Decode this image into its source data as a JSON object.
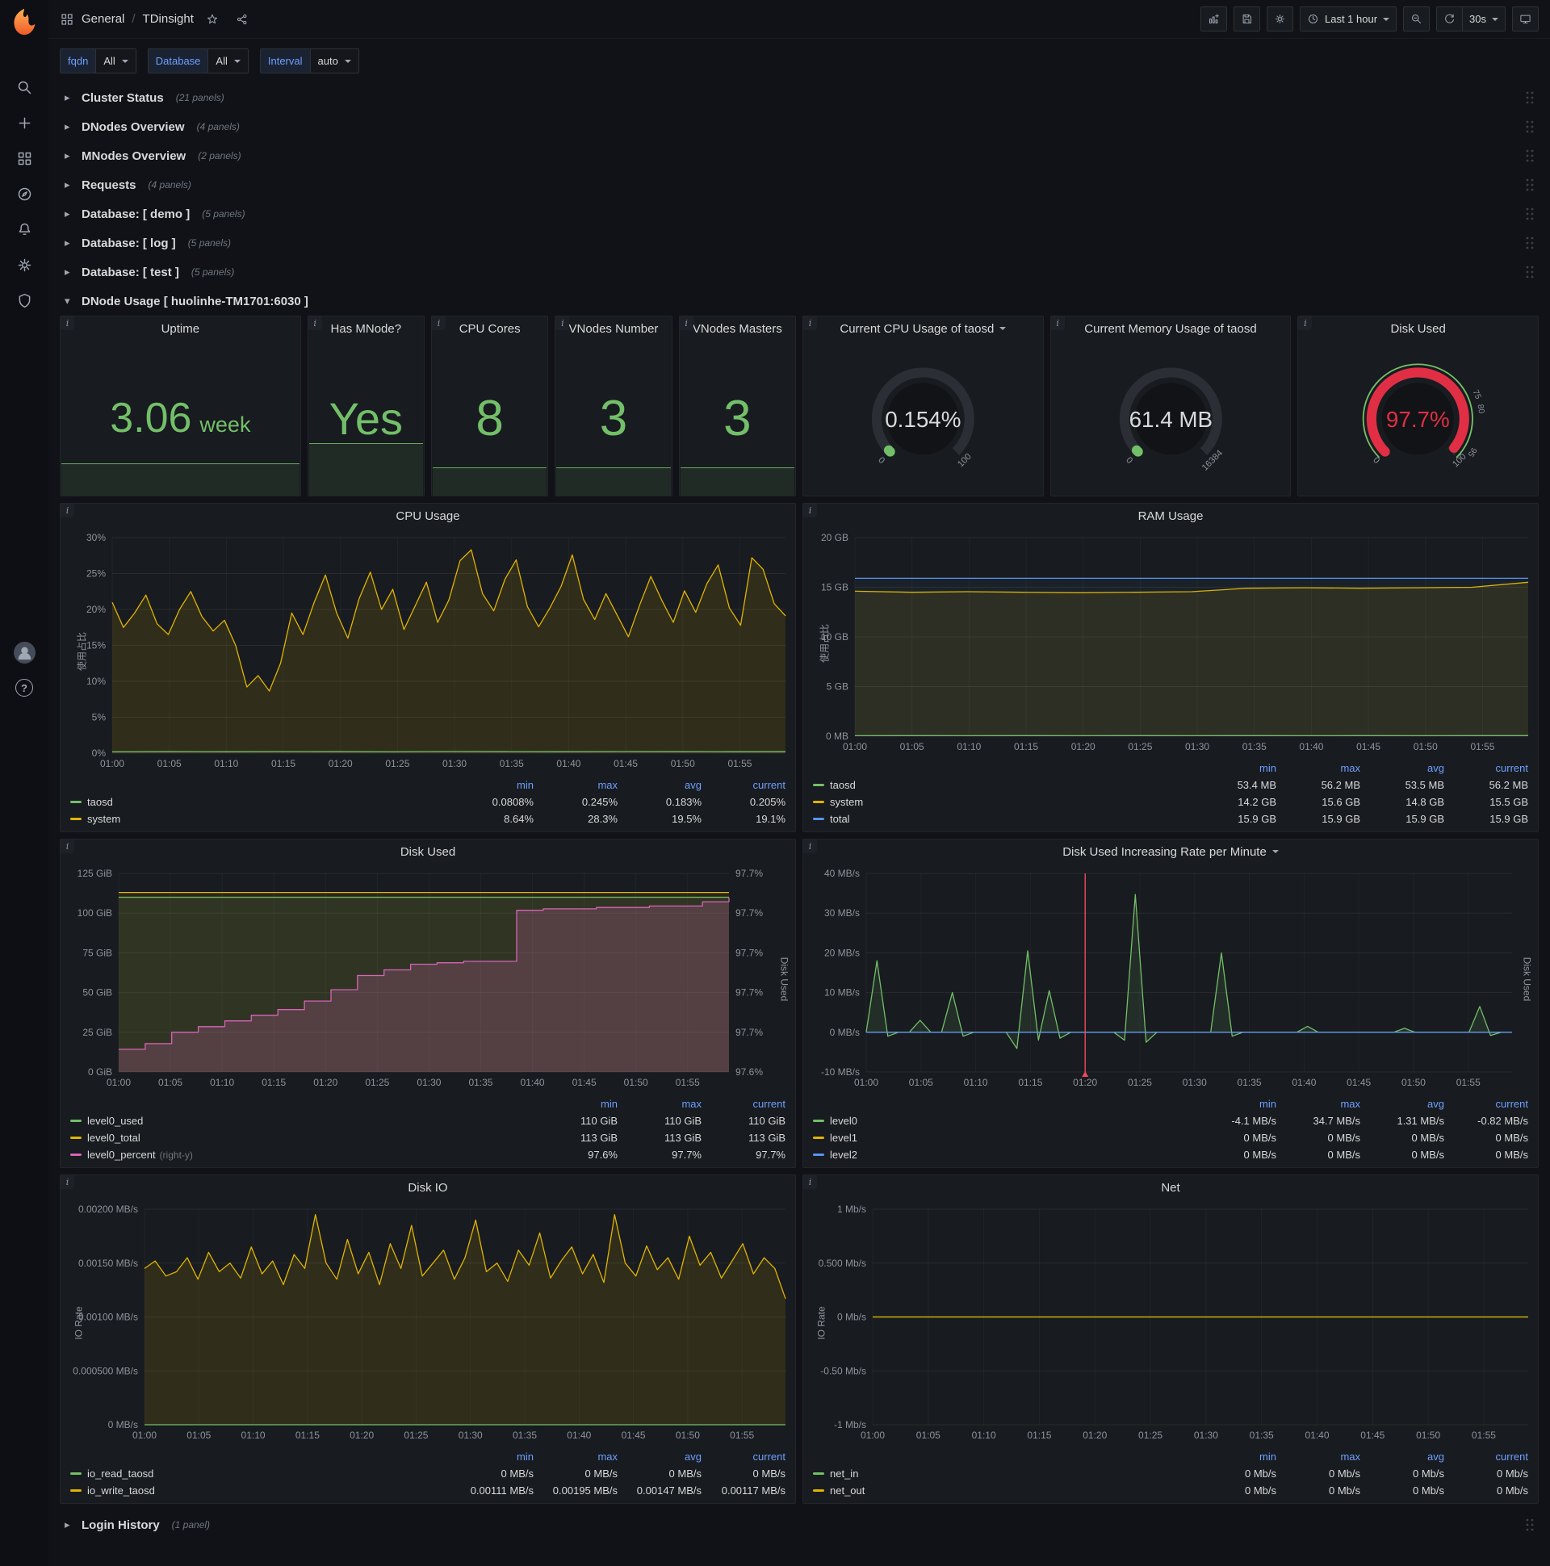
{
  "colors": {
    "green": "#73bf69",
    "yellow": "#e0b400",
    "blue": "#5794f2",
    "pink": "#d864b8",
    "red": "#e02f44"
  },
  "nav": {
    "breadcrumb_section": "General",
    "breadcrumb_sep": "/",
    "title": "TDinsight",
    "time_range": "Last 1 hour",
    "refresh_interval": "30s"
  },
  "variables": [
    {
      "label": "fqdn",
      "value": "All"
    },
    {
      "label": "Database",
      "value": "All"
    },
    {
      "label": "Interval",
      "value": "auto"
    }
  ],
  "collapsed_rows": [
    {
      "title": "Cluster Status",
      "count": "(21 panels)"
    },
    {
      "title": "DNodes Overview",
      "count": "(4 panels)"
    },
    {
      "title": "MNodes Overview",
      "count": "(2 panels)"
    },
    {
      "title": "Requests",
      "count": "(4 panels)"
    },
    {
      "title": "Database: [ demo ]",
      "count": "(5 panels)"
    },
    {
      "title": "Database: [ log ]",
      "count": "(5 panels)"
    },
    {
      "title": "Database: [ test ]",
      "count": "(5 panels)"
    }
  ],
  "expanded_row": {
    "title": "DNode Usage [ huolinhe-TM1701:6030 ]"
  },
  "bottom_row": {
    "title": "Login History",
    "count": "(1 panel)"
  },
  "stats": [
    {
      "title": "Uptime",
      "value": "3.06",
      "unit": "week",
      "spark": 0.21
    },
    {
      "title": "Has MNode?",
      "value": "Yes",
      "unit": "",
      "spark": 0.34
    },
    {
      "title": "CPU Cores",
      "value": "8",
      "unit": "",
      "spark": 0.18
    },
    {
      "title": "VNodes Number",
      "value": "3",
      "unit": "",
      "spark": 0.18
    },
    {
      "title": "VNodes Masters",
      "value": "3",
      "unit": "",
      "spark": 0.18
    }
  ],
  "gauges": [
    {
      "title": "Current CPU Usage of taosd",
      "caret": true,
      "value": "0.154%",
      "pct": 0.154,
      "min_label": "0",
      "max_label": "100",
      "color": "#73bf69",
      "value_color": "#d8d9da",
      "thresholds": []
    },
    {
      "title": "Current Memory Usage of taosd",
      "caret": false,
      "value": "61.4 MB",
      "pct": 0.375,
      "min_label": "0",
      "max_label": "16384",
      "color": "#73bf69",
      "value_color": "#d8d9da",
      "thresholds": []
    },
    {
      "title": "Disk Used",
      "caret": false,
      "value": "97.7%",
      "pct": 97.7,
      "min_label": "0",
      "max_label": "100",
      "color": "#e02f44",
      "value_color": "#e02f44",
      "outer_ring": "#73bf69",
      "thresholds": [
        {
          "pos": 75,
          "label": "75"
        },
        {
          "pos": 80,
          "label": "80"
        },
        {
          "pos": 95,
          "label": "95"
        }
      ]
    }
  ],
  "chart_data": [
    {
      "type": "line",
      "title": "CPU Usage",
      "caret": false,
      "ylabel": "使用占比",
      "ml": 64,
      "ymin": 0,
      "ymax": 30,
      "yticks": [
        "30%",
        "25%",
        "20%",
        "15%",
        "10%",
        "5%",
        "0%"
      ],
      "xticks": [
        "01:00",
        "01:05",
        "01:10",
        "01:15",
        "01:20",
        "01:25",
        "01:30",
        "01:35",
        "01:40",
        "01:45",
        "01:50",
        "01:55"
      ],
      "x_minutes": 59,
      "series": [
        {
          "name": "system",
          "color": "#e0b400",
          "fill": 0.12,
          "values": [
            21.0,
            17.5,
            19.5,
            22.0,
            18.0,
            16.5,
            20.0,
            22.5,
            19.0,
            17.0,
            18.5,
            15.0,
            9.2,
            10.8,
            8.64,
            12.5,
            19.5,
            16.5,
            21.0,
            24.8,
            19.5,
            16.0,
            21.5,
            25.2,
            20.0,
            22.8,
            17.2,
            20.5,
            23.8,
            18.2,
            21.3,
            26.8,
            28.3,
            22.2,
            19.8,
            24.2,
            26.9,
            20.4,
            17.6,
            20.2,
            23.2,
            27.6,
            21.4,
            18.6,
            22.2,
            19.2,
            16.2,
            20.6,
            24.6,
            21.2,
            18.2,
            22.6,
            19.6,
            23.6,
            26.2,
            20.2,
            17.8,
            27.2,
            25.6,
            20.8,
            19.1
          ]
        },
        {
          "name": "taosd",
          "color": "#73bf69",
          "fill": 0.05,
          "values": [
            0.18,
            0.2,
            0.19,
            0.21,
            0.2,
            0.18,
            0.22,
            0.2,
            0.19,
            0.21,
            0.2,
            0.19,
            0.205
          ]
        }
      ],
      "legend": {
        "headers": [
          "min",
          "max",
          "avg",
          "current"
        ],
        "rows": [
          {
            "name": "taosd",
            "color": "#73bf69",
            "values": [
              "0.0808%",
              "0.245%",
              "0.183%",
              "0.205%"
            ]
          },
          {
            "name": "system",
            "color": "#e0b400",
            "values": [
              "8.64%",
              "28.3%",
              "19.5%",
              "19.1%"
            ]
          }
        ]
      }
    },
    {
      "type": "line",
      "title": "RAM Usage",
      "caret": false,
      "ylabel": "使用占比",
      "ml": 64,
      "ymin": 0,
      "ymax": 20,
      "yticks": [
        "20 GB",
        "15 GB",
        "10 GB",
        "5 GB",
        "0 MB"
      ],
      "xticks": [
        "01:00",
        "01:05",
        "01:10",
        "01:15",
        "01:20",
        "01:25",
        "01:30",
        "01:35",
        "01:40",
        "01:45",
        "01:50",
        "01:55"
      ],
      "x_minutes": 59,
      "series": [
        {
          "name": "system",
          "color": "#e0b400",
          "fill": 0.1,
          "values": [
            14.6,
            14.5,
            14.55,
            14.5,
            14.45,
            14.5,
            14.55,
            14.9,
            14.95,
            14.9,
            14.95,
            15.0,
            15.5
          ]
        },
        {
          "name": "total",
          "color": "#5794f2",
          "fill": 0.05,
          "values": [
            15.9,
            15.9,
            15.9,
            15.9,
            15.9,
            15.9,
            15.9,
            15.9,
            15.9,
            15.9,
            15.9,
            15.9,
            15.9
          ]
        },
        {
          "name": "taosd",
          "color": "#73bf69",
          "fill": 0.05,
          "values": [
            0.05,
            0.06,
            0.05,
            0.06,
            0.05,
            0.06,
            0.05,
            0.06,
            0.05,
            0.06,
            0.05,
            0.06,
            0.055
          ]
        }
      ],
      "legend": {
        "headers": [
          "min",
          "max",
          "avg",
          "current"
        ],
        "rows": [
          {
            "name": "taosd",
            "color": "#73bf69",
            "values": [
              "53.4 MB",
              "56.2 MB",
              "53.5 MB",
              "56.2 MB"
            ]
          },
          {
            "name": "system",
            "color": "#e0b400",
            "values": [
              "14.2 GB",
              "15.6 GB",
              "14.8 GB",
              "15.5 GB"
            ]
          },
          {
            "name": "total",
            "color": "#5794f2",
            "values": [
              "15.9 GB",
              "15.9 GB",
              "15.9 GB",
              "15.9 GB"
            ]
          }
        ]
      }
    },
    {
      "type": "line",
      "title": "Disk Used",
      "caret": false,
      "ml": 72,
      "right_title": "Disk Used",
      "ymin": 0,
      "ymax": 125,
      "yticks": [
        "125 GiB",
        "100 GiB",
        "75 GiB",
        "50 GiB",
        "25 GiB",
        "0 GiB"
      ],
      "right": {
        "min": 97.58,
        "max": 97.72
      },
      "right_labels": [
        "97.7%",
        "97.7%",
        "97.7%",
        "97.7%",
        "97.7%",
        "97.6%"
      ],
      "xticks": [
        "01:00",
        "01:05",
        "01:10",
        "01:15",
        "01:20",
        "01:25",
        "01:30",
        "01:35",
        "01:40",
        "01:45",
        "01:50",
        "01:55"
      ],
      "x_minutes": 59,
      "series": [
        {
          "name": "level0_used",
          "color": "#73bf69",
          "fill": 0.1,
          "values": [
            110,
            110,
            110,
            110,
            110,
            110,
            110
          ]
        },
        {
          "name": "level0_total",
          "color": "#e0b400",
          "fill": 0.08,
          "values": [
            113,
            113,
            113,
            113,
            113,
            113,
            113
          ]
        },
        {
          "name": "level0_percent",
          "color": "#d864b8",
          "fill": 0.22,
          "axis": "right",
          "step": true,
          "values": [
            97.596,
            97.6,
            97.608,
            97.612,
            97.616,
            97.62,
            97.624,
            97.63,
            97.638,
            97.648,
            97.652,
            97.656,
            97.657,
            97.658,
            97.658,
            97.694,
            97.695,
            97.695,
            97.696,
            97.696,
            97.697,
            97.697,
            97.7,
            97.703
          ]
        }
      ],
      "legend": {
        "headers": [
          "min",
          "max",
          "current"
        ],
        "rows": [
          {
            "name": "level0_used",
            "color": "#73bf69",
            "values": [
              "110 GiB",
              "110 GiB",
              "110 GiB"
            ]
          },
          {
            "name": "level0_total",
            "color": "#e0b400",
            "values": [
              "113 GiB",
              "113 GiB",
              "113 GiB"
            ]
          },
          {
            "name": "level0_percent",
            "suffix": "(right-y)",
            "color": "#d864b8",
            "values": [
              "97.6%",
              "97.7%",
              "97.7%"
            ]
          }
        ]
      }
    },
    {
      "type": "line",
      "title": "Disk Used Increasing Rate per Minute",
      "caret": true,
      "ml": 78,
      "right_title": "Disk Used",
      "ymin": -10,
      "ymax": 40,
      "yticks": [
        "40 MB/s",
        "30 MB/s",
        "20 MB/s",
        "10 MB/s",
        "0 MB/s",
        "-10 MB/s"
      ],
      "xticks": [
        "01:00",
        "01:05",
        "01:10",
        "01:15",
        "01:20",
        "01:25",
        "01:30",
        "01:35",
        "01:40",
        "01:45",
        "01:50",
        "01:55"
      ],
      "x_minutes": 59,
      "annotation": {
        "frac": 0.339,
        "color": "#f2495c"
      },
      "series": [
        {
          "name": "level0",
          "color": "#73bf69",
          "fill": 0.12,
          "values": [
            0,
            18,
            -1,
            0,
            0,
            3,
            0,
            0,
            10,
            -1,
            0,
            0,
            0,
            0,
            -4.1,
            20.5,
            -2,
            10.5,
            -1.5,
            0,
            0,
            0,
            0,
            0,
            -2,
            34.7,
            -2.5,
            0,
            0,
            0,
            0,
            0,
            0,
            20,
            -1,
            0,
            0,
            0,
            0,
            0,
            0,
            1.5,
            0,
            0,
            0,
            0,
            0,
            0,
            0,
            0,
            1,
            0,
            0,
            0,
            0,
            0,
            0,
            6.5,
            -0.82,
            0,
            0
          ]
        },
        {
          "name": "level1",
          "color": "#e0b400",
          "fill": 0,
          "values": [
            0,
            0
          ]
        },
        {
          "name": "level2",
          "color": "#5794f2",
          "fill": 0,
          "values": [
            0,
            0
          ]
        }
      ],
      "legend": {
        "headers": [
          "min",
          "max",
          "avg",
          "current"
        ],
        "rows": [
          {
            "name": "level0",
            "color": "#73bf69",
            "values": [
              "-4.1 MB/s",
              "34.7 MB/s",
              "1.31 MB/s",
              "-0.82 MB/s"
            ]
          },
          {
            "name": "level1",
            "color": "#e0b400",
            "values": [
              "0 MB/s",
              "0 MB/s",
              "0 MB/s",
              "0 MB/s"
            ]
          },
          {
            "name": "level2",
            "color": "#5794f2",
            "values": [
              "0 MB/s",
              "0 MB/s",
              "0 MB/s",
              "0 MB/s"
            ]
          }
        ]
      }
    },
    {
      "type": "line",
      "title": "Disk IO",
      "caret": false,
      "ylabel": "IO Rate",
      "ml": 104,
      "ymin": 0,
      "ymax": 0.002,
      "yticks": [
        "0.00200 MB/s",
        "0.00150 MB/s",
        "0.00100 MB/s",
        "0.000500 MB/s",
        "0 MB/s"
      ],
      "xticks": [
        "01:00",
        "01:05",
        "01:10",
        "01:15",
        "01:20",
        "01:25",
        "01:30",
        "01:35",
        "01:40",
        "01:45",
        "01:50",
        "01:55"
      ],
      "x_minutes": 59,
      "series": [
        {
          "name": "io_write_taosd",
          "color": "#e0b400",
          "fill": 0.12,
          "values": [
            0.00145,
            0.00152,
            0.00138,
            0.00142,
            0.00155,
            0.00135,
            0.0016,
            0.00142,
            0.0015,
            0.00136,
            0.00165,
            0.0014,
            0.00152,
            0.0013,
            0.00158,
            0.00145,
            0.00195,
            0.0015,
            0.00135,
            0.00172,
            0.0014,
            0.0016,
            0.0013,
            0.00168,
            0.00145,
            0.00185,
            0.00138,
            0.0015,
            0.00162,
            0.00135,
            0.00155,
            0.0019,
            0.00142,
            0.0015,
            0.00133,
            0.00162,
            0.00148,
            0.00178,
            0.00136,
            0.00152,
            0.00165,
            0.0014,
            0.00158,
            0.00132,
            0.00195,
            0.0015,
            0.00138,
            0.00166,
            0.00144,
            0.00155,
            0.00135,
            0.00175,
            0.00148,
            0.0016,
            0.00136,
            0.00152,
            0.00168,
            0.0014,
            0.00155,
            0.00145,
            0.00117
          ]
        },
        {
          "name": "io_read_taosd",
          "color": "#73bf69",
          "fill": 0,
          "values": [
            0,
            0
          ]
        }
      ],
      "legend": {
        "headers": [
          "min",
          "max",
          "avg",
          "current"
        ],
        "rows": [
          {
            "name": "io_read_taosd",
            "color": "#73bf69",
            "values": [
              "0 MB/s",
              "0 MB/s",
              "0 MB/s",
              "0 MB/s"
            ]
          },
          {
            "name": "io_write_taosd",
            "color": "#e0b400",
            "values": [
              "0.00111 MB/s",
              "0.00195 MB/s",
              "0.00147 MB/s",
              "0.00117 MB/s"
            ]
          }
        ]
      }
    },
    {
      "type": "line",
      "title": "Net",
      "caret": false,
      "ylabel": "IO Rate",
      "ml": 86,
      "ymin": -1,
      "ymax": 1,
      "yticks": [
        "1 Mb/s",
        "0.500 Mb/s",
        "0 Mb/s",
        "-0.50 Mb/s",
        "-1 Mb/s"
      ],
      "xticks": [
        "01:00",
        "01:05",
        "01:10",
        "01:15",
        "01:20",
        "01:25",
        "01:30",
        "01:35",
        "01:40",
        "01:45",
        "01:50",
        "01:55"
      ],
      "x_minutes": 59,
      "series": [
        {
          "name": "net_in",
          "color": "#73bf69",
          "fill": 0,
          "values": [
            0,
            0
          ]
        },
        {
          "name": "net_out",
          "color": "#e0b400",
          "fill": 0,
          "values": [
            0,
            0
          ]
        }
      ],
      "legend": {
        "headers": [
          "min",
          "max",
          "avg",
          "current"
        ],
        "rows": [
          {
            "name": "net_in",
            "color": "#73bf69",
            "values": [
              "0 Mb/s",
              "0 Mb/s",
              "0 Mb/s",
              "0 Mb/s"
            ]
          },
          {
            "name": "net_out",
            "color": "#e0b400",
            "values": [
              "0 Mb/s",
              "0 Mb/s",
              "0 Mb/s",
              "0 Mb/s"
            ]
          }
        ]
      }
    }
  ]
}
